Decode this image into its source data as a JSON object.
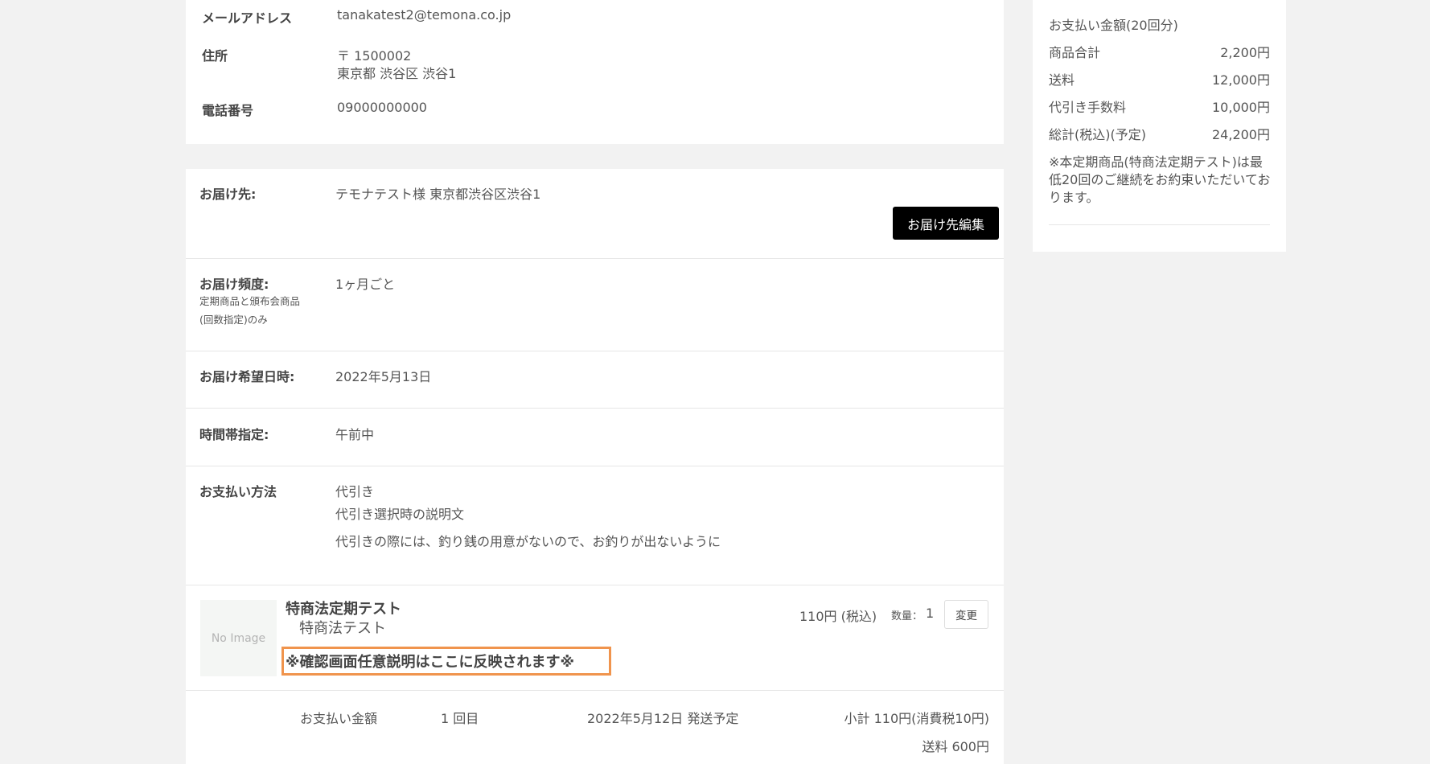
{
  "customer": {
    "email_label": "メールアドレス",
    "email_value": "tanakatest2@temona.co.jp",
    "address_label": "住所",
    "postal": "〒 1500002",
    "address_line": "東京都 渋谷区 渋谷1",
    "phone_label": "電話番号",
    "phone_value": "09000000000"
  },
  "order": {
    "delivery_label": "お届け先:",
    "delivery_value": "テモナテスト様 東京都渋谷区渋谷1",
    "edit_delivery_button": "お届け先編集",
    "frequency_label": "お届け頻度:",
    "frequency_note_line1": "定期商品と頒布会商品",
    "frequency_note_line2": "(回数指定)のみ",
    "frequency_value": "1ヶ月ごと",
    "desired_date_label": "お届け希望日時:",
    "desired_date_value": "2022年5月13日",
    "time_slot_label": "時間帯指定:",
    "time_slot_value": "午前中",
    "payment_label": "お支払い方法",
    "payment_value": "代引き",
    "payment_desc_title": "代引き選択時の説明文",
    "payment_desc": "代引きの際には、釣り銭の用意がないので、お釣りが出ないように"
  },
  "product": {
    "image_placeholder": "No Image",
    "name": "特商法定期テスト",
    "subname": "特商法テスト",
    "description": "※確認画面任意説明はここに反映されます※",
    "price": "110円 (税込)",
    "qty_label": "数量：",
    "qty_value": "1",
    "change_button": "変更"
  },
  "schedule": {
    "payment_label": "お支払い金額",
    "count": "1 回目",
    "ship_date": "2022年5月12日 発送予定",
    "subtotal": "小計 110円(消費税10円)",
    "shipping": "送料 600円"
  },
  "summary": {
    "title": "お支払い金額(20回分)",
    "rows": [
      {
        "label": "商品合計",
        "value": "2,200円"
      },
      {
        "label": "送料",
        "value": "12,000円"
      },
      {
        "label": "代引き手数料",
        "value": "10,000円"
      },
      {
        "label": "総計(税込)(予定)",
        "value": "24,200円"
      }
    ],
    "note_line1": "※本定期商品(特商法定期テスト)は最",
    "note_line2": "低20回のご継続をお約束いただいてお",
    "note_line3": "ります。"
  },
  "colors": {
    "page_bg": "#f2f2f2",
    "card_bg": "#ffffff",
    "dark_button": "#000000",
    "highlight_border": "#f0944d"
  }
}
